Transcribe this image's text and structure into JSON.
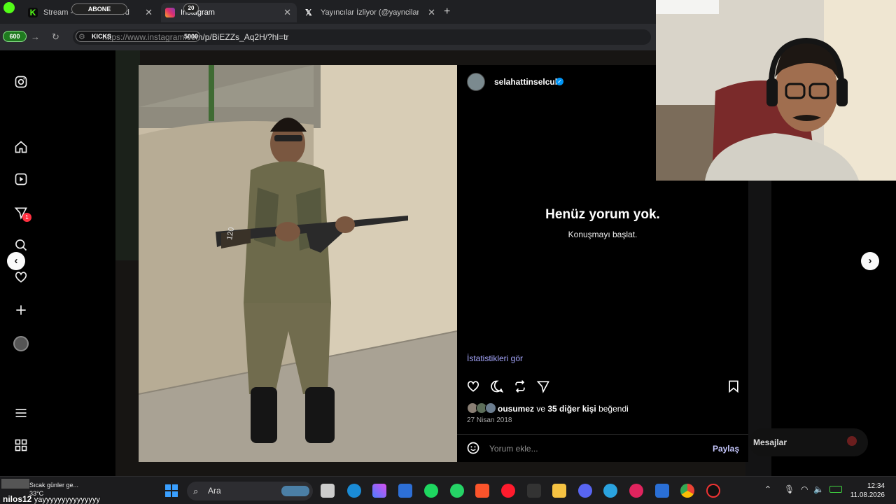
{
  "browser": {
    "tabs": [
      {
        "title": "Stream - Kick Dashboard",
        "active": false,
        "favicon_color": "#53fc18"
      },
      {
        "title": "Instagram",
        "active": true,
        "favicon_color": "#e1306c"
      },
      {
        "title": "Yayıncılar İzliyor (@yayncilarizli",
        "active": false,
        "favicon_color": "#ffffff"
      }
    ],
    "url": "https://www.instagram.com/p/BiEZZs_Aq2H/?hl=tr"
  },
  "overlays": {
    "abone_label": "ABONE",
    "abone_count": "20",
    "kicks_label": "KICKS",
    "kicks_count": "5000",
    "green_count": "600"
  },
  "post": {
    "username": "selahattinselcuk",
    "no_comments_title": "Henüz yorum yok.",
    "no_comments_sub": "Konuşmayı başlat.",
    "stats_link": "İstatistikleri gör",
    "liked_by_user": "ousumez",
    "liked_by_mid": " ve ",
    "liked_by_others": "35 diğer kişi",
    "liked_by_suffix": " beğendi",
    "date": "27 Nisan 2018",
    "comment_placeholder": "Yorum ekle...",
    "comment_submit": "Paylaş",
    "photo_label": "120"
  },
  "sidebar": {
    "notification_badge": "1"
  },
  "messages_label": "Mesajlar",
  "taskbar": {
    "weather_text": "Sıcak günler ge...",
    "weather_temp": "33°C",
    "ticker_user": "nilos12",
    "ticker_message": "yayyyyyyyyyyyyyyy",
    "search_placeholder": "Ara",
    "time": "12:34",
    "date": "11.08.2026"
  },
  "colors": {
    "link_blue": "#a7a8ff",
    "verified": "#0095f6",
    "notification": "#ff3040"
  }
}
